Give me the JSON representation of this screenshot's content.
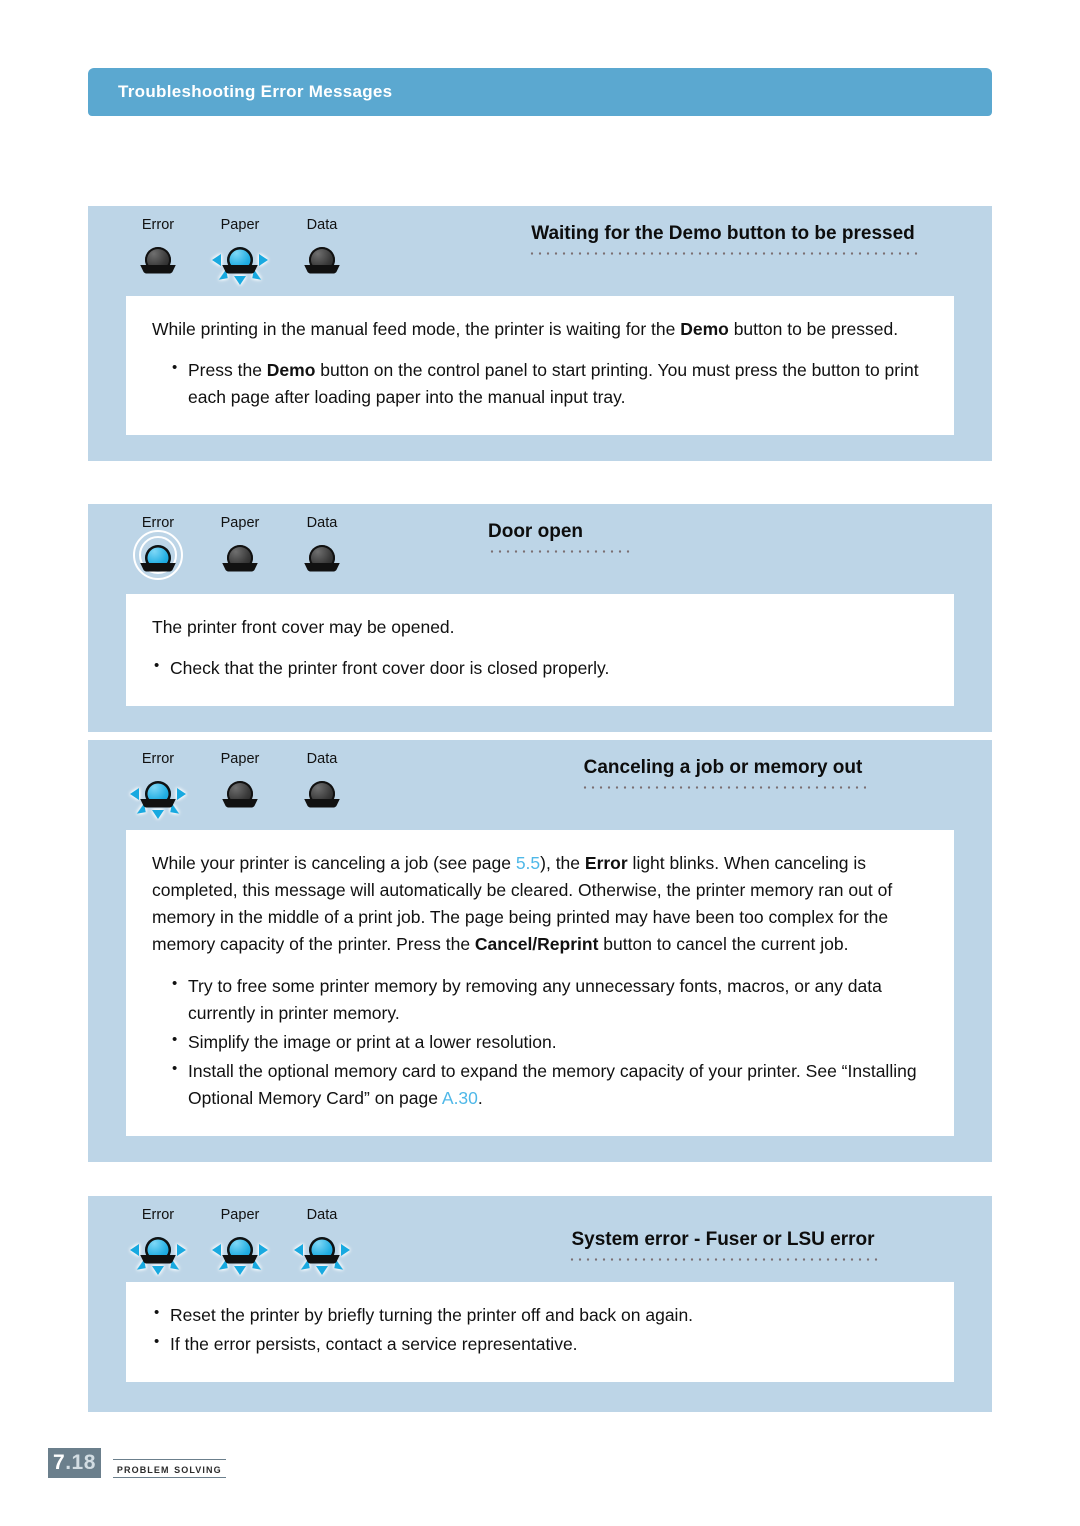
{
  "header": {
    "title": "Troubleshooting Error Messages"
  },
  "sections": [
    {
      "id": "waiting-demo",
      "title": "Waiting for the Demo button to be pressed",
      "leds": [
        {
          "label": "Error",
          "state": "off"
        },
        {
          "label": "Paper",
          "state": "blinking"
        },
        {
          "label": "Data",
          "state": "off"
        }
      ],
      "paragraphs": [
        "While printing in the manual feed mode, the printer is waiting for the Demo button to be pressed."
      ],
      "bullets": [
        "Press the Demo button on the control panel to start printing. You must press the button to print each page after loading paper into the manual input tray."
      ]
    },
    {
      "id": "door-open",
      "title": "Door open",
      "leds": [
        {
          "label": "Error",
          "state": "on"
        },
        {
          "label": "Paper",
          "state": "off"
        },
        {
          "label": "Data",
          "state": "off"
        }
      ],
      "paragraphs": [
        "The printer front cover may be opened."
      ],
      "bullets": [
        "Check that the printer front cover door is closed properly."
      ]
    },
    {
      "id": "canceling-job",
      "title": "Canceling a job or memory out",
      "leds": [
        {
          "label": "Error",
          "state": "blinking"
        },
        {
          "label": "Paper",
          "state": "off"
        },
        {
          "label": "Data",
          "state": "off"
        }
      ],
      "paragraphs": [
        "While your printer is canceling a job (see page 5.5), the Error light blinks. When canceling is completed, this message will automatically be cleared. Otherwise, the printer memory ran out of memory in the middle of a print job. The page being printed may have been too complex for the memory capacity of the printer. Press the Cancel/Reprint button to cancel the current job."
      ],
      "bullets": [
        "Try to free some printer memory by removing any unnecessary fonts, macros, or any data currently in printer memory.",
        "Simplify the image or print at a lower resolution.",
        "Install the optional memory card to expand the memory capacity of your printer. See “Installing Optional Memory Card” on page A.30."
      ],
      "cross_references": [
        "5.5",
        "A.30"
      ]
    },
    {
      "id": "system-error",
      "title": "System error - Fuser or LSU error",
      "leds": [
        {
          "label": "Error",
          "state": "blinking"
        },
        {
          "label": "Paper",
          "state": "blinking"
        },
        {
          "label": "Data",
          "state": "blinking"
        }
      ],
      "paragraphs": [],
      "bullets": [
        "Reset the printer by briefly turning the printer off and back on again.",
        "If the error persists, contact a service representative."
      ]
    }
  ],
  "footer": {
    "page_number_major": "7",
    "page_number_minor": ".18",
    "chapter": "Problem Solving"
  },
  "colors": {
    "header_banner": "#5ba8d0",
    "panel": "#bdd5e7",
    "card": "#ffffff",
    "led_on": "#18a9e0",
    "led_off": "#333333",
    "xref": "#4fb8e8",
    "folio": "#6b7f8c"
  }
}
